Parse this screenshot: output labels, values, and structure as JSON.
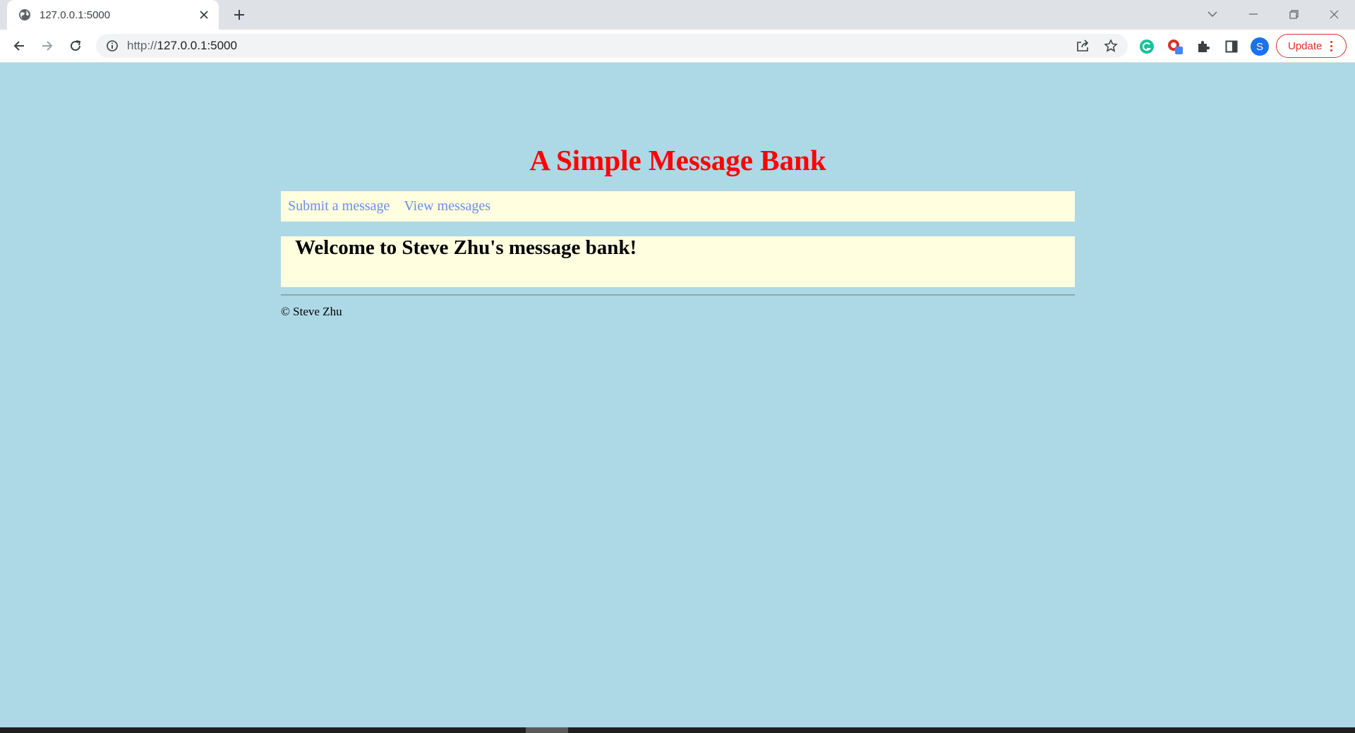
{
  "browser": {
    "tab_title": "127.0.0.1:5000",
    "url_scheme": "http://",
    "url_host": "127.0.0.1:5000",
    "profile_initial": "S",
    "update_label": "Update"
  },
  "page": {
    "title": "A Simple Message Bank",
    "nav": {
      "submit": "Submit a message",
      "view": "View messages"
    },
    "welcome": "Welcome to Steve Zhu's message bank!",
    "footer": "© Steve Zhu"
  },
  "colors": {
    "page_background": "#add8e6",
    "title": "#ff0000",
    "panel": "#fffedf",
    "link": "#6a8ee8"
  }
}
